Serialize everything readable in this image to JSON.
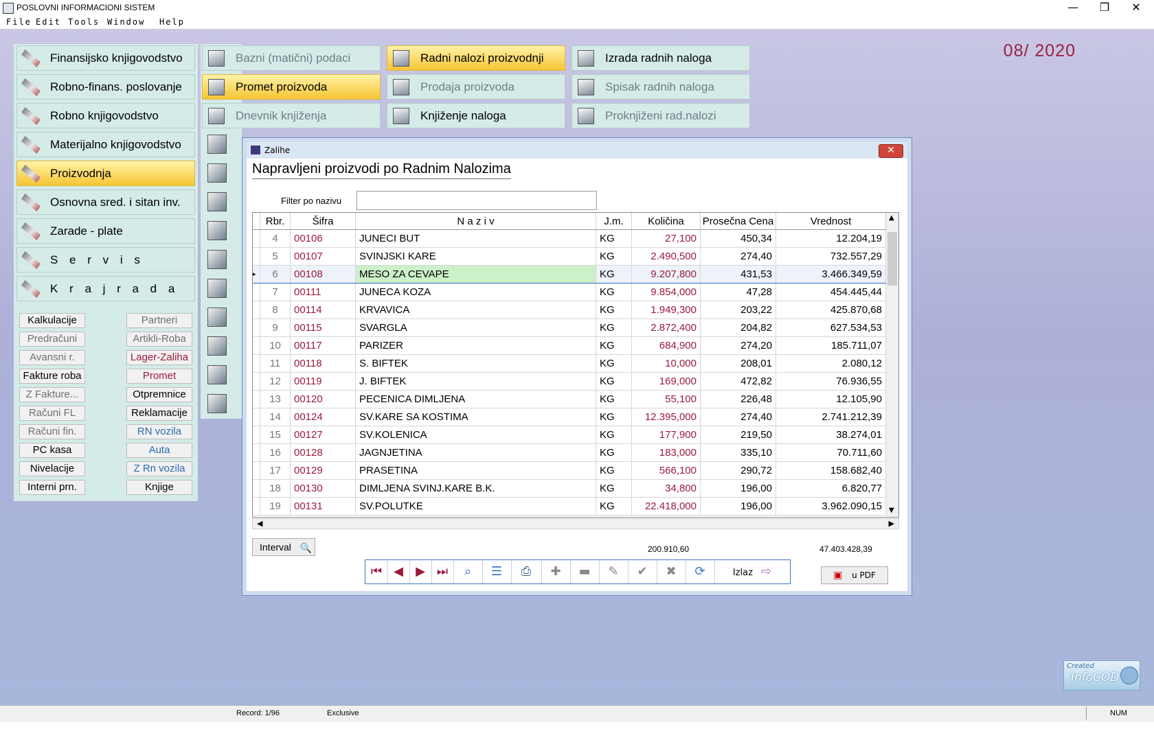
{
  "app": {
    "title": "POSLOVNI INFORMACIONI SISTEM",
    "menu": [
      "File",
      "Edit",
      "Tools",
      "Window",
      "Help"
    ],
    "period": "08/ 2020"
  },
  "window_controls": {
    "minimize": "—",
    "restore": "❐",
    "close": "✕"
  },
  "left_menu": [
    {
      "label": "Finansijsko knjigovodstvo",
      "icon": "pencil-icon"
    },
    {
      "label": "Robno-finans. poslovanje",
      "icon": "calculator-icon"
    },
    {
      "label": "Robno knjigovodstvo",
      "icon": "pencil-icon"
    },
    {
      "label": "Materijalno knjigovodstvo",
      "icon": "pencil-icon"
    },
    {
      "label": "Proizvodnja",
      "icon": "pencil-icon",
      "active": true
    },
    {
      "label": "Osnovna sred. i sitan inv.",
      "icon": "pencil-icon"
    },
    {
      "label": "Zarade - plate",
      "icon": "scissors-icon"
    },
    {
      "label": "S e r v i s",
      "icon": "computer-icon"
    },
    {
      "label": "K r a j   r a d a",
      "icon": "exit-icon"
    }
  ],
  "col2_menu": [
    {
      "label": "Bazni (matični) podaci",
      "dim": true
    },
    {
      "label": "Promet proizvoda",
      "active": true
    },
    {
      "label": "Dnevnik knjiženja",
      "dim": true
    }
  ],
  "col3_menu": [
    {
      "label": "Radni nalozi proizvodnji",
      "active": true
    },
    {
      "label": "Prodaja proizvoda",
      "dim": true
    },
    {
      "label": "Knjiženje naloga",
      "dim": false
    }
  ],
  "col4_menu": [
    {
      "label": "Izrada radnih naloga",
      "dim": false
    },
    {
      "label": "Spisak radnih naloga",
      "dim": true
    },
    {
      "label": "Proknjiženi rad.nalozi",
      "dim": true
    }
  ],
  "small_left": [
    {
      "label": "Kalkulacije",
      "style": ""
    },
    {
      "label": "Predračuni",
      "style": "dim"
    },
    {
      "label": "Avansni r.",
      "style": "dim"
    },
    {
      "label": "Fakture roba",
      "style": ""
    },
    {
      "label": "Z Fakture...",
      "style": "dim"
    },
    {
      "label": "Računi FL",
      "style": "dim"
    },
    {
      "label": "Računi fin.",
      "style": "dim"
    },
    {
      "label": "PC kasa",
      "style": ""
    },
    {
      "label": "Nivelacije",
      "style": ""
    },
    {
      "label": "Interni prn.",
      "style": ""
    }
  ],
  "small_right": [
    {
      "label": "Partneri",
      "style": "dim"
    },
    {
      "label": "Artikli-Roba",
      "style": "dim"
    },
    {
      "label": "Lager-Zaliha",
      "style": "red"
    },
    {
      "label": "Promet",
      "style": "red"
    },
    {
      "label": "Otpremnice",
      "style": ""
    },
    {
      "label": "Reklamacije",
      "style": ""
    },
    {
      "label": "RN vozila",
      "style": "blue"
    },
    {
      "label": "Auta",
      "style": "blue"
    },
    {
      "label": "Z Rn vozila",
      "style": "blue"
    },
    {
      "label": "Knjige",
      "style": ""
    }
  ],
  "dialog": {
    "title": "Zalihe",
    "heading": "Napravljeni proizvodi po Radnim Nalozima",
    "filter_label": "Filter po nazivu",
    "filter_value": "",
    "columns": [
      "Rbr.",
      "Šifra",
      "N a z i v",
      "J.m.",
      "Količina",
      "Prosečna Cena",
      "Vrednost"
    ],
    "rows": [
      [
        "4",
        "00106",
        "JUNECI BUT",
        "KG",
        "27,100",
        "450,34",
        "12.204,19"
      ],
      [
        "5",
        "00107",
        "SVINJSKI KARE",
        "KG",
        "2.490,500",
        "274,40",
        "732.557,29"
      ],
      [
        "6",
        "00108",
        "MESO ZA CEVAPE",
        "KG",
        "9.207,800",
        "431,53",
        "3.466.349,59"
      ],
      [
        "7",
        "00111",
        "JUNECA KOZA",
        "KG",
        "9.854,000",
        "47,28",
        "454.445,44"
      ],
      [
        "8",
        "00114",
        "KRVAVICA",
        "KG",
        "1.949,300",
        "203,22",
        "425.870,68"
      ],
      [
        "9",
        "00115",
        "SVARGLA",
        "KG",
        "2.872,400",
        "204,82",
        "627.534,53"
      ],
      [
        "10",
        "00117",
        "PARIZER",
        "KG",
        "684,900",
        "274,20",
        "185.711,07"
      ],
      [
        "11",
        "00118",
        "S. BIFTEK",
        "KG",
        "10,000",
        "208,01",
        "2.080,12"
      ],
      [
        "12",
        "00119",
        "J. BIFTEK",
        "KG",
        "169,000",
        "472,82",
        "76.936,55"
      ],
      [
        "13",
        "00120",
        "PECENICA DIMLJENA",
        "KG",
        "55,100",
        "226,48",
        "12.105,90"
      ],
      [
        "14",
        "00124",
        "SV.KARE SA KOSTIMA",
        "KG",
        "12.395,000",
        "274,40",
        "2.741.212,39"
      ],
      [
        "15",
        "00127",
        "SV.KOLENICA",
        "KG",
        "177,900",
        "219,50",
        "38.274,01"
      ],
      [
        "16",
        "00128",
        "JAGNJETINA",
        "KG",
        "183,000",
        "335,10",
        "70.711,60"
      ],
      [
        "17",
        "00129",
        "PRASETINA",
        "KG",
        "566,100",
        "290,72",
        "158.682,40"
      ],
      [
        "18",
        "00130",
        "DIMLJENA SVINJ.KARE B.K.",
        "KG",
        "34,800",
        "196,00",
        "6.820,77"
      ],
      [
        "19",
        "00131",
        "SV.POLUTKE",
        "KG",
        "22.418,000",
        "196,00",
        "3.962.090,15"
      ]
    ],
    "current_row_index": 2,
    "interval_label": "Interval",
    "sum_quantity": "200.910,60",
    "sum_value": "47.403.428,39",
    "toolbar": {
      "first": "⏮",
      "prev": "◀",
      "next": "▶",
      "last": "⏭",
      "izlaz": "Izlaz",
      "pdf": "u PDF"
    }
  },
  "statusbar": {
    "record": "Record: 1/96",
    "mode": "Exclusive",
    "num": "NUM"
  },
  "logo": {
    "line1": "Created",
    "line2": "InfoCOD"
  },
  "colors": {
    "accent_red": "#9a1a3c",
    "menu_bg": "#d4ebe8",
    "highlight": "#f6c533"
  }
}
